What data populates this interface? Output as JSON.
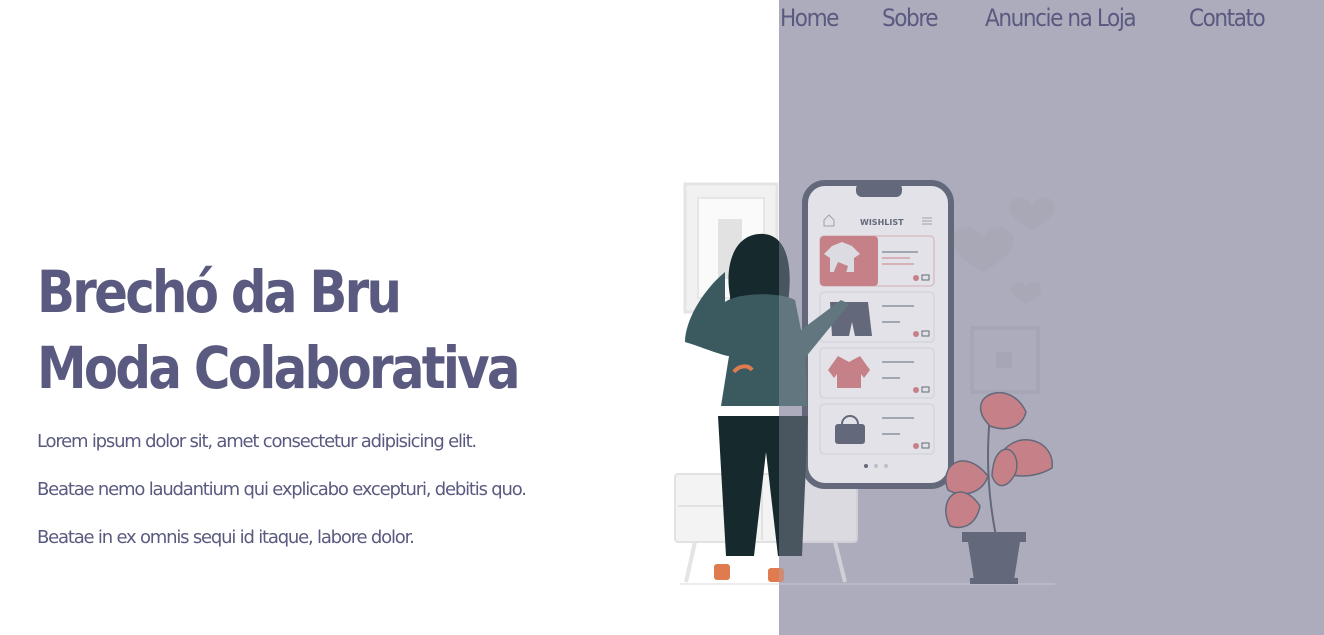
{
  "nav": {
    "items": [
      {
        "label": "Home"
      },
      {
        "label": "Sobre"
      },
      {
        "label": "Anuncie na Loja"
      },
      {
        "label": "Contato"
      }
    ]
  },
  "hero": {
    "title_line1": "Brechó da Bru",
    "title_line2": "Moda Colaborativa",
    "text_line1": "Lorem ipsum dolor sit, amet consectetur adipisicing elit.",
    "text_line2": "Beatae nemo laudantium qui explicabo excepturi, debitis quo.",
    "text_line3": "Beatae in ex omnis sequi id itaque, labore dolor."
  },
  "illustration": {
    "app_title": "WISHLIST",
    "icon": "woman-shopping-wishlist-illustration"
  },
  "colors": {
    "accent": "#5a5a80",
    "panel": "#adacbd",
    "background": "#ffffff",
    "highlight": "#d36a6a"
  }
}
